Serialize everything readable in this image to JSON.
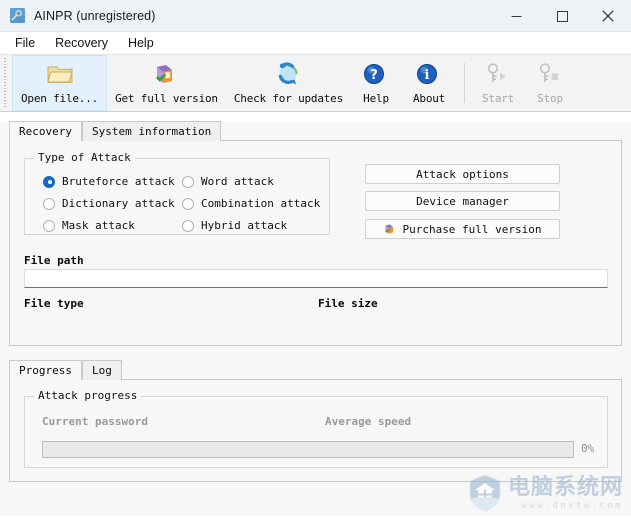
{
  "window": {
    "title": "AINPR (unregistered)",
    "icon": "key-app-icon",
    "controls": {
      "minimize": "minimize-icon",
      "maximize": "maximize-icon",
      "close": "close-icon"
    }
  },
  "menu": {
    "items": [
      {
        "label": "File"
      },
      {
        "label": "Recovery"
      },
      {
        "label": "Help"
      }
    ]
  },
  "toolbar": {
    "buttons": [
      {
        "label": "Open file...",
        "icon": "folder-open-icon",
        "state": "highlighted",
        "enabled": true
      },
      {
        "label": "Get full version",
        "icon": "purchase-box-icon",
        "state": "normal",
        "enabled": true
      },
      {
        "label": "Check for updates",
        "icon": "refresh-globe-icon",
        "state": "normal",
        "enabled": true
      },
      {
        "label": "Help",
        "icon": "question-mark-icon",
        "state": "normal",
        "enabled": true
      },
      {
        "label": "About",
        "icon": "info-icon",
        "state": "normal",
        "enabled": true
      },
      {
        "label": "Start",
        "icon": "key-play-icon",
        "state": "disabled",
        "enabled": false
      },
      {
        "label": "Stop",
        "icon": "key-stop-icon",
        "state": "disabled",
        "enabled": false
      }
    ]
  },
  "main_tabs": {
    "items": [
      {
        "label": "Recovery",
        "active": true
      },
      {
        "label": "System information",
        "active": false
      }
    ]
  },
  "recovery": {
    "attack_group": {
      "title": "Type of Attack",
      "options": [
        {
          "label": "Bruteforce attack",
          "checked": true
        },
        {
          "label": "Dictionary attack",
          "checked": false
        },
        {
          "label": "Mask attack",
          "checked": false
        },
        {
          "label": "Word attack",
          "checked": false
        },
        {
          "label": "Combination attack",
          "checked": false
        },
        {
          "label": "Hybrid attack",
          "checked": false
        }
      ]
    },
    "buttons": [
      {
        "label": "Attack options",
        "icon": null
      },
      {
        "label": "Device manager",
        "icon": null
      },
      {
        "label": "Purchase full version",
        "icon": "purchase-box-icon"
      }
    ],
    "file_path": {
      "label": "File path",
      "value": "",
      "placeholder": ""
    },
    "file_type": {
      "label": "File type",
      "value": ""
    },
    "file_size": {
      "label": "File size",
      "value": ""
    }
  },
  "bottom_tabs": {
    "items": [
      {
        "label": "Progress",
        "active": true
      },
      {
        "label": "Log",
        "active": false
      }
    ]
  },
  "progress": {
    "group_title": "Attack progress",
    "current_password": {
      "label": "Current password",
      "value": ""
    },
    "average_speed": {
      "label": "Average speed",
      "value": ""
    },
    "percent_label": "0%",
    "percent_value": 0
  },
  "watermark": {
    "badge": "shield-house-icon",
    "text_cn": "电脑系统网",
    "url": "www.dnxtw.com"
  },
  "colors": {
    "titlebar_bg": "#eef2f7",
    "toolbar_bg": "#f3f3f3",
    "content_bg": "#f7f7f7",
    "accent_blue": "#1569c7",
    "disabled_text": "#a6a6a6",
    "highlight_bg": "#e4f0fb"
  }
}
